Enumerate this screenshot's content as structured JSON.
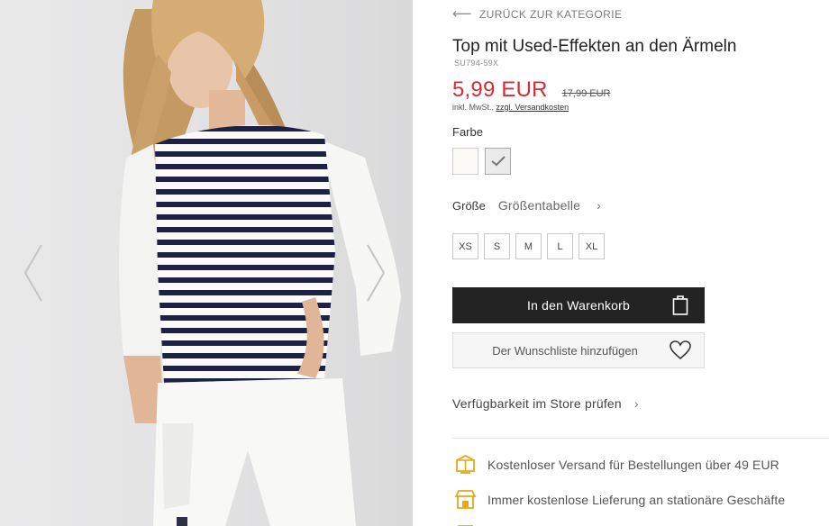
{
  "gallery": {
    "prev_icon": "chevron-left-icon",
    "next_icon": "chevron-right-icon"
  },
  "product": {
    "back_label": "Zurück zur Kategorie",
    "title": "Top mit Used-Effekten an den Ärmeln",
    "sku": "SU794-59X",
    "price": "5,99 EUR",
    "old_price": "17,99 EUR",
    "tax_prefix": "inkl. MwSt.,",
    "tax_link": "zzgl. Versandkosten",
    "price_color": "#d12e37"
  },
  "color": {
    "label": "Farbe",
    "swatches": [
      "#fbfaf7",
      "#ebebeb"
    ],
    "selected_index": 1
  },
  "size": {
    "label": "Größe",
    "chart_label": "Größentabelle",
    "options": [
      "XS",
      "S",
      "M",
      "L",
      "XL"
    ]
  },
  "actions": {
    "add_to_cart": "In den Warenkorb",
    "wishlist": "Der Wunschliste hinzufügen",
    "availability": "Verfügbarkeit im Store prüfen"
  },
  "benefits": [
    {
      "icon": "shipping-box-icon",
      "text": "Kostenloser Versand für Bestellungen über 49 EUR"
    },
    {
      "icon": "store-icon",
      "text": "Immer kostenlose Lieferung an stationäre Geschäfte"
    },
    {
      "icon": "return-icon",
      "text": ""
    }
  ],
  "colors": {
    "accent": "#d12e37",
    "button_dark": "#232323",
    "benefit_icon": "#e6a817"
  }
}
